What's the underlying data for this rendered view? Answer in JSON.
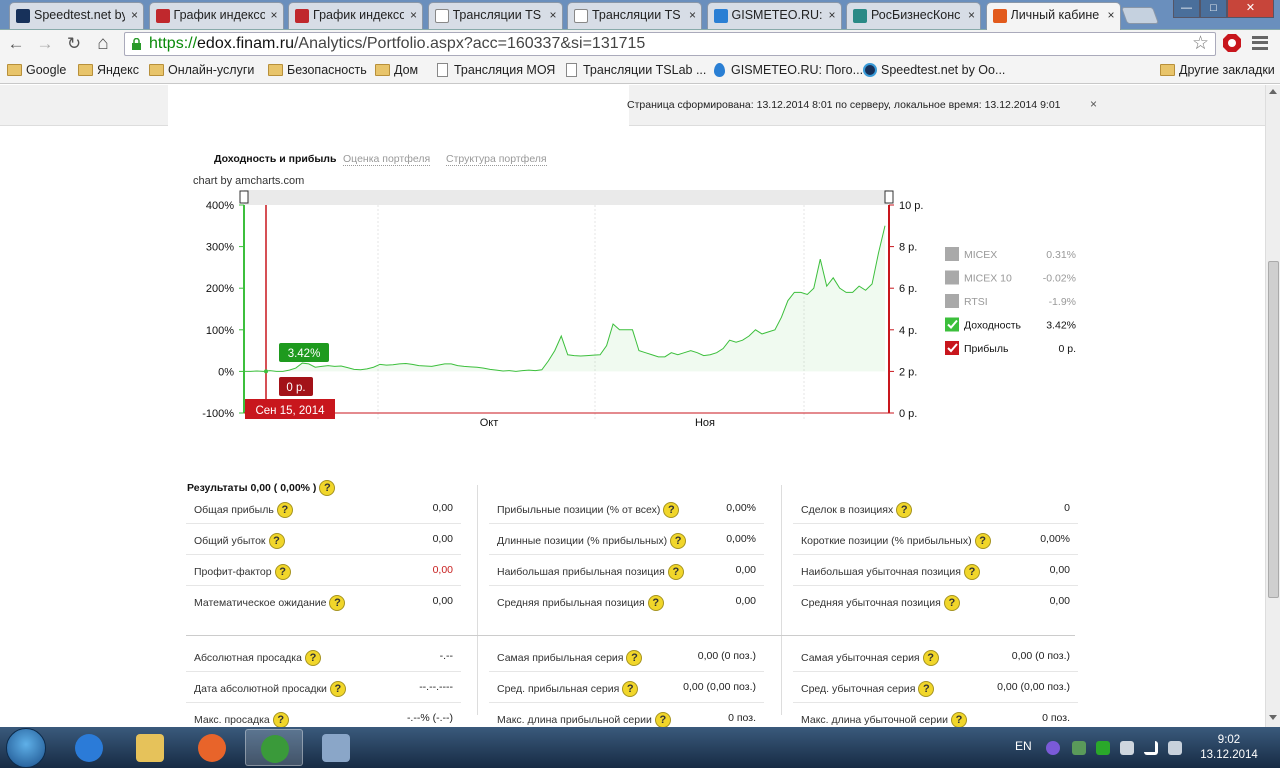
{
  "browser": {
    "tabs": [
      {
        "label": "Speedtest.net by",
        "icon_color": "#17315a"
      },
      {
        "label": "График индексо",
        "icon_color": "#c0282d"
      },
      {
        "label": "График индексо",
        "icon_color": "#c0282d"
      },
      {
        "label": "Трансляции TS",
        "icon_color": "#ffffff"
      },
      {
        "label": "Трансляции TS",
        "icon_color": "#ffffff"
      },
      {
        "label": "GISMETEO.RU: П",
        "icon_color": "#2a7fd4"
      },
      {
        "label": "РосБизнесКонс",
        "icon_color": "#2a8a86"
      },
      {
        "label": "Личный кабине",
        "icon_color": "#e25a1c",
        "active": true
      }
    ],
    "tab_close": "×",
    "window_controls": {
      "minimize": "—",
      "maximize": "□",
      "close": "✕"
    },
    "nav": {
      "back": "←",
      "forward": "→",
      "reload": "↻",
      "home": "⌂"
    },
    "url": {
      "scheme": "https://",
      "host": "edox.finam.ru",
      "path": "/Analytics/Portfolio.aspx?acc=160337&si=131715"
    },
    "star": "☆",
    "bookmarks": [
      {
        "label": "Google",
        "icon": "folder-icon"
      },
      {
        "label": "Яндекс",
        "icon": "folder-icon"
      },
      {
        "label": "Онлайн-услуги",
        "icon": "folder-icon"
      },
      {
        "label": "Безопасность",
        "icon": "folder-icon"
      },
      {
        "label": "Дом",
        "icon": "folder-icon"
      },
      {
        "label": "Трансляция МОЯ",
        "icon": "page-icon"
      },
      {
        "label": "Трансляции TSLab ...",
        "icon": "page-icon"
      },
      {
        "label": "GISMETEO.RU: Пого...",
        "icon": "drop-icon"
      },
      {
        "label": "Speedtest.net by Oo...",
        "icon": "speedtest-icon"
      }
    ],
    "other_bookmarks": "Другие закладки"
  },
  "page": {
    "info": "Страница сформирована: 13.12.2014 8:01 по серверу, локальное время: 13.12.2014 9:01",
    "close": "×",
    "tabs": [
      {
        "label": "Доходность и прибыль",
        "active": true
      },
      {
        "label": "Оценка портфеля",
        "active": false
      },
      {
        "label": "Структура портфеля",
        "active": false
      }
    ],
    "credit": "chart by amcharts.com"
  },
  "chart_data": {
    "type": "line",
    "y_left_ticks": [
      "400%",
      "300%",
      "200%",
      "100%",
      "0%",
      "-100%"
    ],
    "y_right_ticks": [
      "10 р.",
      "8 р.",
      "6 р.",
      "4 р.",
      "2 р.",
      "0 р."
    ],
    "ylim_left": [
      -100,
      400
    ],
    "ylim_right": [
      0,
      10
    ],
    "x_labels": [
      "Сен 15, 2014",
      "Окт",
      "Ноя"
    ],
    "cursor_value": "3.42%",
    "cursor_profit": "0 р.",
    "cursor_date": "Сен 15, 2014",
    "series": [
      {
        "name": "Доходность",
        "color": "#3cbf3c",
        "values": [
          0,
          0,
          1,
          0,
          2,
          0,
          0,
          3,
          8,
          20,
          18,
          10,
          12,
          14,
          12,
          13,
          9,
          5,
          4,
          6,
          10,
          17,
          15,
          16,
          18,
          19,
          17,
          14,
          13,
          12,
          15,
          18,
          18,
          14,
          12,
          11,
          10,
          8,
          5,
          3,
          1,
          2,
          0,
          2,
          3,
          2,
          4,
          25,
          50,
          85,
          40,
          38,
          37,
          38,
          39,
          40,
          62,
          114,
          100,
          100,
          100,
          50,
          45,
          40,
          35,
          35,
          45,
          40,
          45,
          50,
          45,
          38,
          40,
          45,
          55,
          75,
          70,
          75,
          85,
          100,
          90,
          95,
          100,
          130,
          170,
          190,
          190,
          185,
          200,
          270,
          205,
          225,
          200,
          190,
          190,
          205,
          195,
          210,
          285,
          350
        ]
      }
    ],
    "legend": [
      {
        "name": "MICEX",
        "value": "0.31%",
        "checked": false,
        "color": "#a9a9a9"
      },
      {
        "name": "MICEX 10",
        "value": "-0.02%",
        "checked": false,
        "color": "#a9a9a9"
      },
      {
        "name": "RTSI",
        "value": "-1.9%",
        "checked": false,
        "color": "#a9a9a9"
      },
      {
        "name": "Доходность",
        "value": "3.42%",
        "checked": true,
        "color": "#3cbf3c"
      },
      {
        "name": "Прибыль",
        "value": "0 р.",
        "checked": true,
        "color": "#c8161d"
      }
    ]
  },
  "results": {
    "title": "Результаты 0,00 ( 0,00% )",
    "help": "?",
    "col1": [
      {
        "label": "Общая прибыль",
        "value": "0,00"
      },
      {
        "label": "Общий убыток",
        "value": "0,00"
      },
      {
        "label": "Профит-фактор",
        "value": "0,00",
        "red": true
      },
      {
        "label": "Математическое ожидание",
        "value": "0,00"
      },
      {
        "label": "Абсолютная просадка",
        "value": "-.--"
      },
      {
        "label": "Дата абсолютной просадки",
        "value": "--.--.----"
      },
      {
        "label": "Макс. просадка",
        "value": "-.--% (-.--)"
      }
    ],
    "col2": [
      {
        "label": "Прибыльные позиции (% от всех)",
        "value": "0,00%"
      },
      {
        "label": "Длинные позиции (% прибыльных)",
        "value": "0,00%"
      },
      {
        "label": "Наибольшая прибыльная позиция",
        "value": "0,00"
      },
      {
        "label": "Средняя прибыльная позиция",
        "value": "0,00"
      },
      {
        "label": "Самая прибыльная серия",
        "value": "0,00 (0 поз.)"
      },
      {
        "label": "Сред. прибыльная серия",
        "value": "0,00 (0,00 поз.)"
      },
      {
        "label": "Макс. длина прибыльной серии",
        "value": "0 поз."
      }
    ],
    "col3": [
      {
        "label": "Сделок в позициях",
        "value": "0"
      },
      {
        "label": "Короткие позиции (% прибыльных)",
        "value": "0,00%"
      },
      {
        "label": "Наибольшая убыточная позиция",
        "value": "0,00"
      },
      {
        "label": "Средняя убыточная позиция",
        "value": "0,00"
      },
      {
        "label": "Самая убыточная серия",
        "value": "0,00 (0 поз.)"
      },
      {
        "label": "Сред. убыточная серия",
        "value": "0,00 (0,00 поз.)"
      },
      {
        "label": "Макс. длина убыточной серии",
        "value": "0 поз."
      }
    ]
  },
  "taskbar": {
    "apps": [
      {
        "name": "ie-icon",
        "color": "#2b7bd8"
      },
      {
        "name": "explorer-icon",
        "color": "#e6c25a"
      },
      {
        "name": "firefox-icon",
        "color": "#e8642a"
      },
      {
        "name": "chrome-icon",
        "color": "#3a9a3a",
        "active": true
      },
      {
        "name": "remote-desktop-icon",
        "color": "#8aa6c8"
      }
    ],
    "lang": "EN",
    "time": "9:02",
    "date": "13.12.2014"
  }
}
